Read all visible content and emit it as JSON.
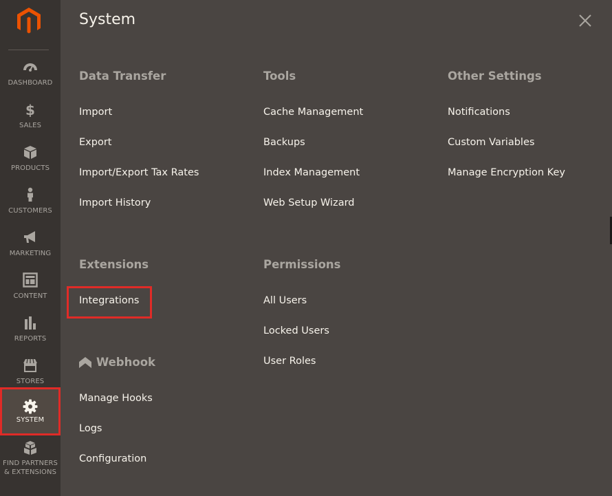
{
  "sidebar": {
    "logo_icon": "magento-logo-icon",
    "items": [
      {
        "key": "dashboard",
        "label": "DASHBOARD",
        "icon": "gauge-icon"
      },
      {
        "key": "sales",
        "label": "SALES",
        "icon": "dollar-icon"
      },
      {
        "key": "products",
        "label": "PRODUCTS",
        "icon": "box-icon"
      },
      {
        "key": "customers",
        "label": "CUSTOMERS",
        "icon": "person-icon"
      },
      {
        "key": "marketing",
        "label": "MARKETING",
        "icon": "megaphone-icon"
      },
      {
        "key": "content",
        "label": "CONTENT",
        "icon": "layout-icon"
      },
      {
        "key": "reports",
        "label": "REPORTS",
        "icon": "bar-chart-icon"
      },
      {
        "key": "stores",
        "label": "STORES",
        "icon": "storefront-icon"
      },
      {
        "key": "system",
        "label": "SYSTEM",
        "icon": "gear-icon",
        "active": true
      },
      {
        "key": "find_partners",
        "label": "FIND PARTNERS",
        "label2": "& EXTENSIONS",
        "icon": "cubes-icon"
      }
    ]
  },
  "panel": {
    "title": "System",
    "close_icon": "close-icon",
    "groups": {
      "data_transfer": {
        "title": "Data Transfer",
        "links": [
          "Import",
          "Export",
          "Import/Export Tax Rates",
          "Import History"
        ]
      },
      "tools": {
        "title": "Tools",
        "links": [
          "Cache Management",
          "Backups",
          "Index Management",
          "Web Setup Wizard"
        ]
      },
      "other_settings": {
        "title": "Other Settings",
        "links": [
          "Notifications",
          "Custom Variables",
          "Manage Encryption Key"
        ]
      },
      "extensions": {
        "title": "Extensions",
        "links": [
          "Integrations"
        ]
      },
      "permissions": {
        "title": "Permissions",
        "links": [
          "All Users",
          "Locked Users",
          "User Roles"
        ]
      },
      "webhook": {
        "title": "Webhook",
        "icon": "webhook-chevron-icon",
        "links": [
          "Manage Hooks",
          "Logs",
          "Configuration"
        ]
      }
    }
  },
  "colors": {
    "sidebar_bg": "#373330",
    "panel_bg": "#4a4542",
    "active_bg": "#514943",
    "highlight": "#e02b27",
    "logo_orange": "#eb5202"
  }
}
